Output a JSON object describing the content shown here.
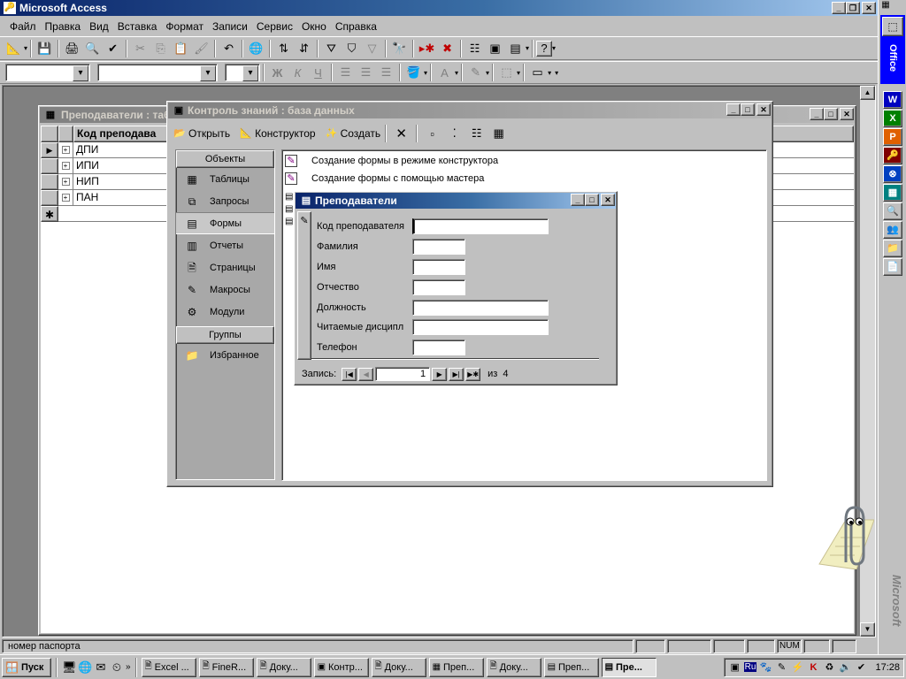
{
  "app": {
    "title": "Microsoft Access"
  },
  "menu": [
    "Файл",
    "Правка",
    "Вид",
    "Вставка",
    "Формат",
    "Записи",
    "Сервис",
    "Окно",
    "Справка"
  ],
  "table_window": {
    "title": "Преподаватели : таб",
    "column_header": "Код преподава",
    "rows": [
      "ДПИ",
      "ИПИ",
      "НИП",
      "ПАН"
    ]
  },
  "db_window": {
    "title": "Контроль знаний : база данных",
    "toolbar": {
      "open": "Открыть",
      "design": "Конструктор",
      "create": "Создать"
    },
    "objects_header": "Объекты",
    "objects": [
      "Таблицы",
      "Запросы",
      "Формы",
      "Отчеты",
      "Страницы",
      "Макросы",
      "Модули"
    ],
    "selected_object": "Формы",
    "groups_header": "Группы",
    "groups": [
      "Избранное"
    ],
    "list_items": [
      "Создание формы в режиме конструктора",
      "Создание формы с помощью мастера"
    ]
  },
  "form_window": {
    "title": "Преподаватели",
    "fields": [
      {
        "label": "Код преподавателя",
        "value": ""
      },
      {
        "label": "Фамилия",
        "value": ""
      },
      {
        "label": "Имя",
        "value": ""
      },
      {
        "label": "Отчество",
        "value": ""
      },
      {
        "label": "Должность",
        "value": ""
      },
      {
        "label": "Читаемые дисципл",
        "value": ""
      },
      {
        "label": "Телефон",
        "value": ""
      }
    ],
    "record_label": "Запись:",
    "record_number": "1",
    "record_of": "из",
    "record_total": "4"
  },
  "status": {
    "text": "номер паспорта",
    "num": "NUM"
  },
  "office_bar": {
    "label": "Office",
    "brand": "Microsoft"
  },
  "taskbar": {
    "start": "Пуск",
    "buttons": [
      "Excel ...",
      "FineR...",
      "Доку...",
      "Контр...",
      "Доку...",
      "Преп...",
      "Доку...",
      "Преп...",
      "Пре..."
    ],
    "active_index": 8,
    "lang": "Ru",
    "clock": "17:28"
  },
  "colors": {
    "title_active": "#0a246a",
    "title_inactive": "#808080",
    "desktop_mdi": "#808080",
    "face": "#c0c0c0",
    "office_bar": "#0000ff"
  }
}
